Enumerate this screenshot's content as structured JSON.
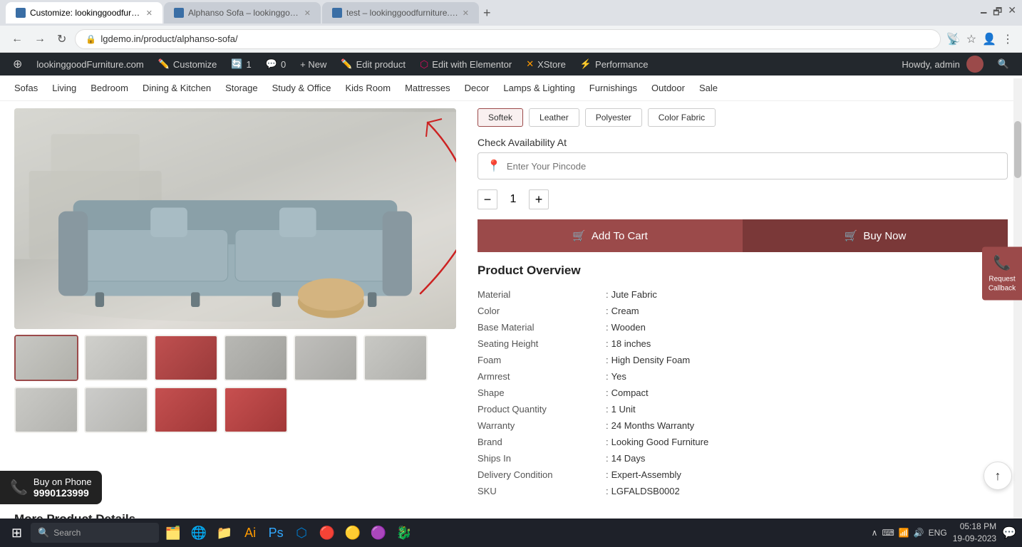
{
  "browser": {
    "tabs": [
      {
        "label": "Customize: lookinggoodfurnitur...",
        "active": true,
        "icon": "wp"
      },
      {
        "label": "Alphanso Sofa – lookinggoodfur...",
        "active": false,
        "icon": "wp"
      },
      {
        "label": "test – lookinggoodfurniture.com",
        "active": false,
        "icon": "wp"
      }
    ],
    "address": "lgdemo.in/product/alphanso-sofa/",
    "new_tab_btn": "+"
  },
  "wp_admin_bar": {
    "items": [
      {
        "label": "lookinggoodFurniture.com",
        "icon": "🏠"
      },
      {
        "label": "Customize",
        "icon": "✏️"
      },
      {
        "label": "1",
        "icon": "🔄"
      },
      {
        "label": "0",
        "icon": "💬"
      },
      {
        "label": "+ New",
        "icon": ""
      },
      {
        "label": "Edit product",
        "icon": "✏️"
      },
      {
        "label": "Edit with Elementor",
        "icon": ""
      },
      {
        "label": "XStore",
        "icon": ""
      },
      {
        "label": "Performance",
        "icon": "⚡"
      }
    ],
    "howdy": "Howdy, admin",
    "search_icon": "🔍"
  },
  "site_nav": {
    "items": [
      "Sofas",
      "Living",
      "Bedroom",
      "Dining & Kitchen",
      "Storage",
      "Study & Office",
      "Kids Room",
      "Mattresses",
      "Decor",
      "Lamps & Lighting",
      "Furnishings",
      "Outdoor",
      "Sale"
    ]
  },
  "product": {
    "swatches": [
      "Softek",
      "Leather",
      "Polyester",
      "Color Fabric"
    ],
    "availability": {
      "label": "Check Availability At",
      "placeholder": "Enter Your Pincode"
    },
    "quantity": 1,
    "buttons": {
      "add_to_cart": "Add To Cart",
      "buy_now": "Buy Now"
    },
    "overview": {
      "title": "Product Overview",
      "rows": [
        {
          "key": "Material",
          "value": "Jute Fabric"
        },
        {
          "key": "Color",
          "value": "Cream"
        },
        {
          "key": "Base Material",
          "value": "Wooden"
        },
        {
          "key": "Seating Height",
          "value": "18 inches"
        },
        {
          "key": "Foam",
          "value": "High Density Foam"
        },
        {
          "key": "Armrest",
          "value": "Yes"
        },
        {
          "key": "Shape",
          "value": "Compact"
        },
        {
          "key": "Product Quantity",
          "value": "1 Unit"
        },
        {
          "key": "Warranty",
          "value": "24 Months Warranty"
        },
        {
          "key": "Brand",
          "value": "Looking Good Furniture"
        },
        {
          "key": "Ships In",
          "value": "14 Days"
        },
        {
          "key": "Delivery Condition",
          "value": "Expert-Assembly"
        },
        {
          "key": "SKU",
          "value": "LGFALDSB0002"
        }
      ]
    }
  },
  "callback": {
    "label": "Request Callback",
    "icon": "📞"
  },
  "buy_on_phone": {
    "label": "Buy on Phone",
    "number": "9990123999",
    "icon": "📞"
  },
  "more_details": {
    "title": "More Product Details"
  },
  "taskbar": {
    "time": "05:18 PM",
    "date": "19-09-2023",
    "language": "ENG",
    "apps": [
      "⊞",
      "🔍",
      "🗂️",
      "🌐",
      "📁",
      "🎨",
      "📝",
      "🔵",
      "🟠",
      "🔺",
      "🟣",
      "🐉"
    ]
  }
}
